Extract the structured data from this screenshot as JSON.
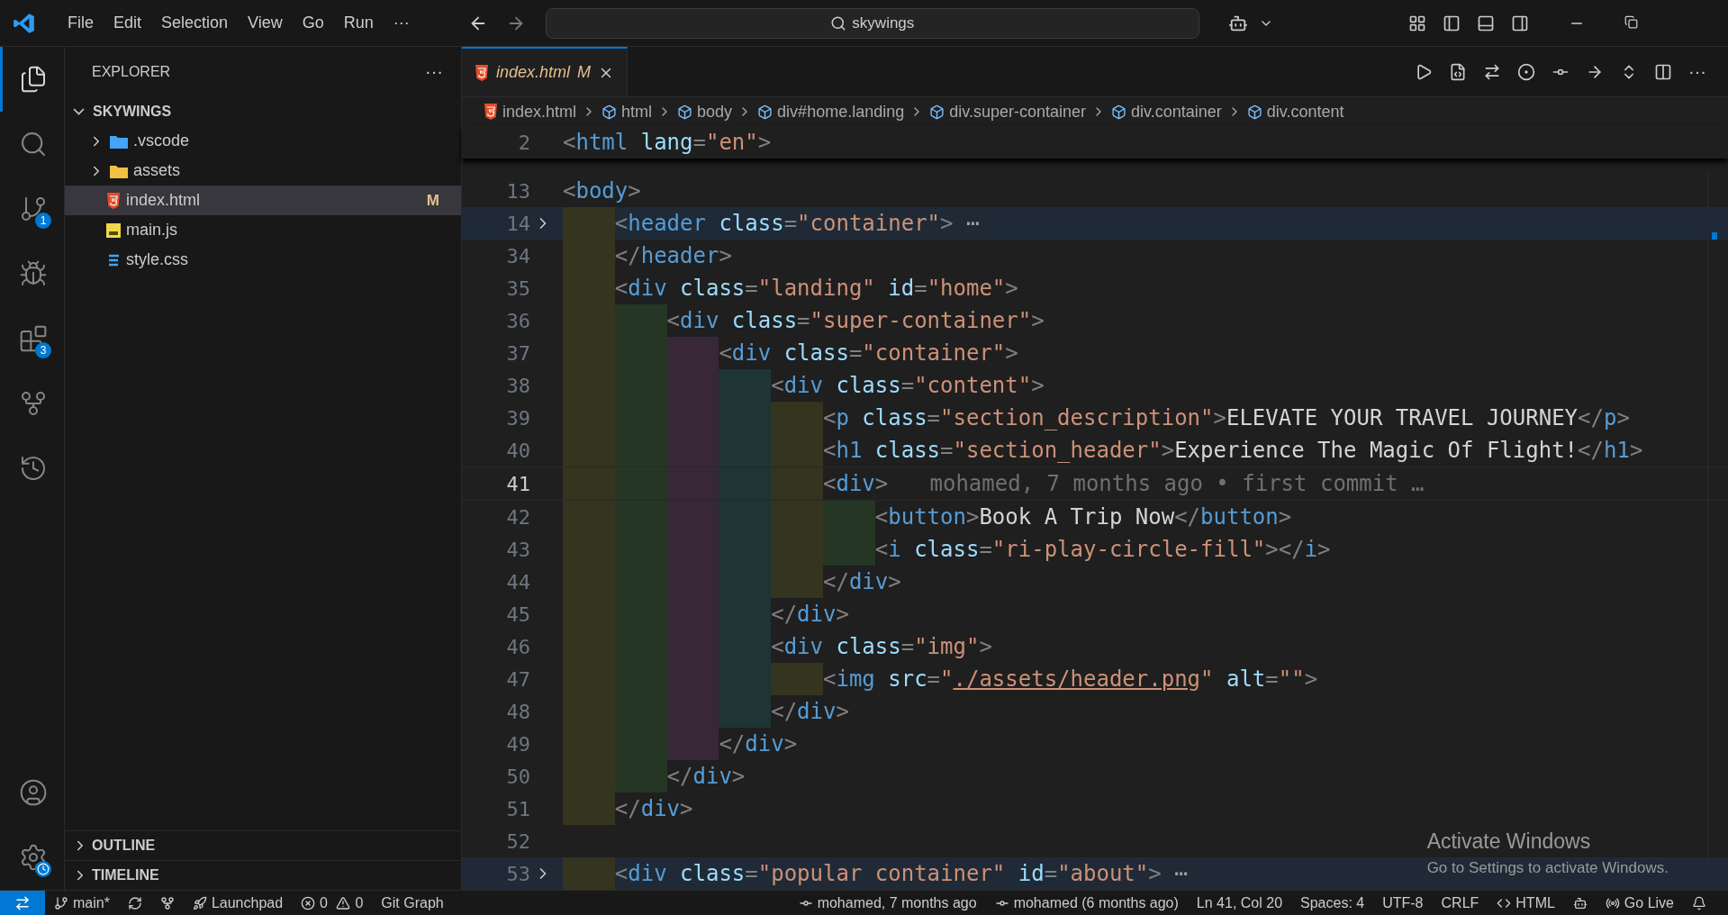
{
  "title_bar": {
    "menu": [
      "File",
      "Edit",
      "Selection",
      "View",
      "Go",
      "Run",
      "···"
    ],
    "search": "skywings"
  },
  "activity_bar": {
    "items": [
      {
        "kind": "files",
        "selected": true
      },
      {
        "kind": "search",
        "selected": false
      },
      {
        "kind": "source",
        "selected": false,
        "badge": "1"
      },
      {
        "kind": "debug",
        "selected": false
      },
      {
        "kind": "extensions",
        "selected": false,
        "badge": "3"
      },
      {
        "kind": "graph",
        "selected": false
      },
      {
        "kind": "history",
        "selected": false
      }
    ]
  },
  "sidebar": {
    "title": "EXPLORER",
    "more": "···",
    "project": "SKYWINGS",
    "items": [
      {
        "name": ".vscode",
        "kind": "folder-vscode",
        "selected": false
      },
      {
        "name": "assets",
        "kind": "folder",
        "selected": false
      },
      {
        "name": "index.html",
        "kind": "html",
        "selected": true,
        "status": "M"
      },
      {
        "name": "main.js",
        "kind": "js",
        "selected": false
      },
      {
        "name": "style.css",
        "kind": "css",
        "selected": false
      }
    ],
    "panels": [
      "OUTLINE",
      "TIMELINE"
    ]
  },
  "tab": {
    "label": "index.html",
    "status": "M",
    "selected": true
  },
  "breadcrumbs": [
    {
      "label": "index.html",
      "kind": "html"
    },
    {
      "label": "html",
      "kind": "element"
    },
    {
      "label": "body",
      "kind": "element"
    },
    {
      "label": "div#home.landing",
      "kind": "element"
    },
    {
      "label": "div.super-container",
      "kind": "element"
    },
    {
      "label": "div.container",
      "kind": "element"
    },
    {
      "label": "div.content",
      "kind": "element"
    }
  ],
  "sticky_line": {
    "number": "2",
    "tokens": [
      {
        "kind": "p",
        "text": "<"
      },
      {
        "kind": "t",
        "text": "html"
      },
      {
        "kind": "a",
        "text": " lang"
      },
      {
        "kind": "p",
        "text": "="
      },
      {
        "kind": "s",
        "text": "\"en\""
      },
      {
        "kind": "p",
        "text": ">"
      }
    ]
  },
  "lines": [
    {
      "number": "13",
      "tokens": [
        {
          "kind": "p",
          "text": "<"
        },
        {
          "kind": "t",
          "text": "body"
        },
        {
          "kind": "p",
          "text": ">"
        }
      ]
    },
    {
      "number": "14",
      "folded": true,
      "tokens": [
        {
          "kind": "p",
          "text": "    <"
        },
        {
          "kind": "t",
          "text": "header"
        },
        {
          "kind": "a",
          "text": " class"
        },
        {
          "kind": "p",
          "text": "="
        },
        {
          "kind": "s",
          "text": "\"container\""
        },
        {
          "kind": "p",
          "text": ">"
        },
        {
          "kind": "fold",
          "text": " ⋯"
        }
      ]
    },
    {
      "number": "34",
      "tokens": [
        {
          "kind": "p",
          "text": "    </"
        },
        {
          "kind": "t",
          "text": "header"
        },
        {
          "kind": "p",
          "text": ">"
        }
      ]
    },
    {
      "number": "35",
      "tokens": [
        {
          "kind": "p",
          "text": "    <"
        },
        {
          "kind": "t",
          "text": "div"
        },
        {
          "kind": "a",
          "text": " class"
        },
        {
          "kind": "p",
          "text": "="
        },
        {
          "kind": "s",
          "text": "\"landing\""
        },
        {
          "kind": "a",
          "text": " id"
        },
        {
          "kind": "p",
          "text": "="
        },
        {
          "kind": "s",
          "text": "\"home\""
        },
        {
          "kind": "p",
          "text": ">"
        }
      ]
    },
    {
      "number": "36",
      "tokens": [
        {
          "kind": "p",
          "text": "        <"
        },
        {
          "kind": "t",
          "text": "div"
        },
        {
          "kind": "a",
          "text": " class"
        },
        {
          "kind": "p",
          "text": "="
        },
        {
          "kind": "s",
          "text": "\"super-container\""
        },
        {
          "kind": "p",
          "text": ">"
        }
      ]
    },
    {
      "number": "37",
      "tokens": [
        {
          "kind": "p",
          "text": "            <"
        },
        {
          "kind": "t",
          "text": "div"
        },
        {
          "kind": "a",
          "text": " class"
        },
        {
          "kind": "p",
          "text": "="
        },
        {
          "kind": "s",
          "text": "\"container\""
        },
        {
          "kind": "p",
          "text": ">"
        }
      ]
    },
    {
      "number": "38",
      "tokens": [
        {
          "kind": "p",
          "text": "                <"
        },
        {
          "kind": "t",
          "text": "div"
        },
        {
          "kind": "a",
          "text": " class"
        },
        {
          "kind": "p",
          "text": "="
        },
        {
          "kind": "s",
          "text": "\"content\""
        },
        {
          "kind": "p",
          "text": ">"
        }
      ]
    },
    {
      "number": "39",
      "tokens": [
        {
          "kind": "p",
          "text": "                    <"
        },
        {
          "kind": "t",
          "text": "p"
        },
        {
          "kind": "a",
          "text": " class"
        },
        {
          "kind": "p",
          "text": "="
        },
        {
          "kind": "s",
          "text": "\"section_description\""
        },
        {
          "kind": "p",
          "text": ">"
        },
        {
          "kind": "x",
          "text": "ELEVATE YOUR TRAVEL JOURNEY"
        },
        {
          "kind": "p",
          "text": "</"
        },
        {
          "kind": "t",
          "text": "p"
        },
        {
          "kind": "p",
          "text": ">"
        }
      ]
    },
    {
      "number": "40",
      "tokens": [
        {
          "kind": "p",
          "text": "                    <"
        },
        {
          "kind": "t",
          "text": "h1"
        },
        {
          "kind": "a",
          "text": " class"
        },
        {
          "kind": "p",
          "text": "="
        },
        {
          "kind": "s",
          "text": "\"section_header\""
        },
        {
          "kind": "p",
          "text": ">"
        },
        {
          "kind": "x",
          "text": "Experience The Magic Of Flight!"
        },
        {
          "kind": "p",
          "text": "</"
        },
        {
          "kind": "t",
          "text": "h1"
        },
        {
          "kind": "p",
          "text": ">"
        }
      ]
    },
    {
      "number": "41",
      "current": true,
      "blame": "mohamed, 7 months ago • first commit …",
      "tokens": [
        {
          "kind": "p",
          "text": "                    <"
        },
        {
          "kind": "t",
          "text": "div"
        },
        {
          "kind": "p",
          "text": ">"
        }
      ]
    },
    {
      "number": "42",
      "tokens": [
        {
          "kind": "p",
          "text": "                        <"
        },
        {
          "kind": "t",
          "text": "button"
        },
        {
          "kind": "p",
          "text": ">"
        },
        {
          "kind": "x",
          "text": "Book A Trip Now"
        },
        {
          "kind": "p",
          "text": "</"
        },
        {
          "kind": "t",
          "text": "button"
        },
        {
          "kind": "p",
          "text": ">"
        }
      ]
    },
    {
      "number": "43",
      "tokens": [
        {
          "kind": "p",
          "text": "                        <"
        },
        {
          "kind": "t",
          "text": "i"
        },
        {
          "kind": "a",
          "text": " class"
        },
        {
          "kind": "p",
          "text": "="
        },
        {
          "kind": "s",
          "text": "\"ri-play-circle-fill\""
        },
        {
          "kind": "p",
          "text": "></"
        },
        {
          "kind": "t",
          "text": "i"
        },
        {
          "kind": "p",
          "text": ">"
        }
      ]
    },
    {
      "number": "44",
      "tokens": [
        {
          "kind": "p",
          "text": "                    </"
        },
        {
          "kind": "t",
          "text": "div"
        },
        {
          "kind": "p",
          "text": ">"
        }
      ]
    },
    {
      "number": "45",
      "tokens": [
        {
          "kind": "p",
          "text": "                </"
        },
        {
          "kind": "t",
          "text": "div"
        },
        {
          "kind": "p",
          "text": ">"
        }
      ]
    },
    {
      "number": "46",
      "tokens": [
        {
          "kind": "p",
          "text": "                <"
        },
        {
          "kind": "t",
          "text": "div"
        },
        {
          "kind": "a",
          "text": " class"
        },
        {
          "kind": "p",
          "text": "="
        },
        {
          "kind": "s",
          "text": "\"img\""
        },
        {
          "kind": "p",
          "text": ">"
        }
      ]
    },
    {
      "number": "47",
      "tokens": [
        {
          "kind": "p",
          "text": "                    <"
        },
        {
          "kind": "t",
          "text": "img"
        },
        {
          "kind": "a",
          "text": " src"
        },
        {
          "kind": "p",
          "text": "="
        },
        {
          "kind": "s",
          "text": "\""
        },
        {
          "kind": "link",
          "text": "./assets/header.png"
        },
        {
          "kind": "s",
          "text": "\""
        },
        {
          "kind": "a",
          "text": " alt"
        },
        {
          "kind": "p",
          "text": "="
        },
        {
          "kind": "s",
          "text": "\"\""
        },
        {
          "kind": "p",
          "text": ">"
        }
      ]
    },
    {
      "number": "48",
      "tokens": [
        {
          "kind": "p",
          "text": "                </"
        },
        {
          "kind": "t",
          "text": "div"
        },
        {
          "kind": "p",
          "text": ">"
        }
      ]
    },
    {
      "number": "49",
      "tokens": [
        {
          "kind": "p",
          "text": "            </"
        },
        {
          "kind": "t",
          "text": "div"
        },
        {
          "kind": "p",
          "text": ">"
        }
      ]
    },
    {
      "number": "50",
      "tokens": [
        {
          "kind": "p",
          "text": "        </"
        },
        {
          "kind": "t",
          "text": "div"
        },
        {
          "kind": "p",
          "text": ">"
        }
      ]
    },
    {
      "number": "51",
      "tokens": [
        {
          "kind": "p",
          "text": "    </"
        },
        {
          "kind": "t",
          "text": "div"
        },
        {
          "kind": "p",
          "text": ">"
        }
      ]
    },
    {
      "number": "52"
    },
    {
      "number": "53",
      "folded": true,
      "tokens": [
        {
          "kind": "p",
          "text": "    <"
        },
        {
          "kind": "t",
          "text": "div"
        },
        {
          "kind": "a",
          "text": " class"
        },
        {
          "kind": "p",
          "text": "="
        },
        {
          "kind": "s",
          "text": "\"popular container\""
        },
        {
          "kind": "a",
          "text": " id"
        },
        {
          "kind": "p",
          "text": "="
        },
        {
          "kind": "s",
          "text": "\"about\""
        },
        {
          "kind": "p",
          "text": ">"
        },
        {
          "kind": "fold",
          "text": " ⋯"
        }
      ]
    }
  ],
  "activation": {
    "title": "Activate Windows",
    "subtitle": "Go to Settings to activate Windows."
  },
  "status_bar": {
    "left": [
      {
        "kind": "branch",
        "label": "main*"
      },
      {
        "kind": "sync"
      },
      {
        "kind": "gitcmd"
      },
      {
        "kind": "launchpad",
        "label": "Launchpad"
      },
      {
        "kind": "problems",
        "errors": "0",
        "warnings": "0"
      },
      {
        "kind": "plain",
        "label": "Git Graph"
      }
    ],
    "right": [
      {
        "kind": "commit",
        "label": "mohamed, 7 months ago"
      },
      {
        "kind": "commit",
        "label": "mohamed (6 months ago)"
      },
      {
        "kind": "plain",
        "label": "Ln 41, Col 20"
      },
      {
        "kind": "plain",
        "label": "Spaces: 4"
      },
      {
        "kind": "plain",
        "label": "UTF-8"
      },
      {
        "kind": "plain",
        "label": "CRLF"
      },
      {
        "kind": "lang",
        "label": "HTML"
      },
      {
        "kind": "copilot"
      },
      {
        "kind": "live",
        "label": "Go Live"
      },
      {
        "kind": "bell"
      }
    ]
  }
}
